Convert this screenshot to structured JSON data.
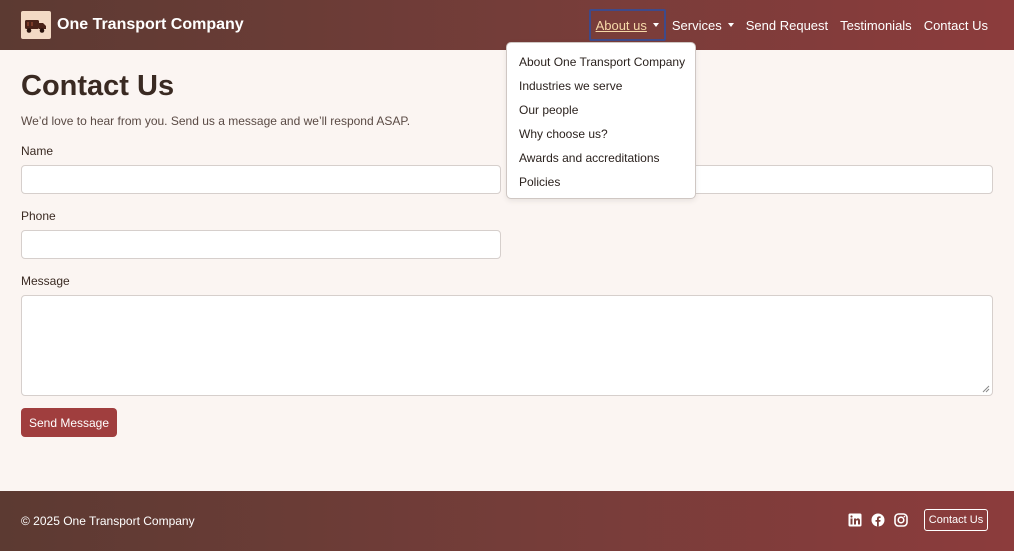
{
  "brand": {
    "name": "One Transport Company",
    "logo_icon": "truck-icon"
  },
  "nav": {
    "items": [
      {
        "label": "About us",
        "has_caret": true
      },
      {
        "label": "Services",
        "has_caret": true
      },
      {
        "label": "Send Request"
      },
      {
        "label": "Testimonials"
      },
      {
        "label": "Contact Us"
      }
    ],
    "about_menu": [
      "About One Transport Company",
      "Industries we serve",
      "Our people",
      "Why choose us?",
      "Awards and accreditations",
      "Policies"
    ]
  },
  "main": {
    "title": "Contact Us",
    "subtitle": "We’d love to hear from you. Send us a message and we’ll respond ASAP.",
    "form": {
      "name_label": "Name",
      "name_value": "",
      "email_value": "",
      "phone_label": "Phone",
      "phone_value": "",
      "message_label": "Message",
      "message_value": "",
      "submit_label": "Send Message"
    }
  },
  "footer": {
    "copyright": "© 2025 One Transport Company",
    "social_icons": [
      "linkedin-icon",
      "facebook-icon",
      "instagram-icon"
    ],
    "contact_button": "Contact Us"
  },
  "colors": {
    "nav_gradient_start": "#5c3a32",
    "nav_gradient_end": "#8c3c3c",
    "accent": "#a03e3e",
    "background": "#fbf5f2",
    "active_nav_text": "#f6d9a8"
  }
}
